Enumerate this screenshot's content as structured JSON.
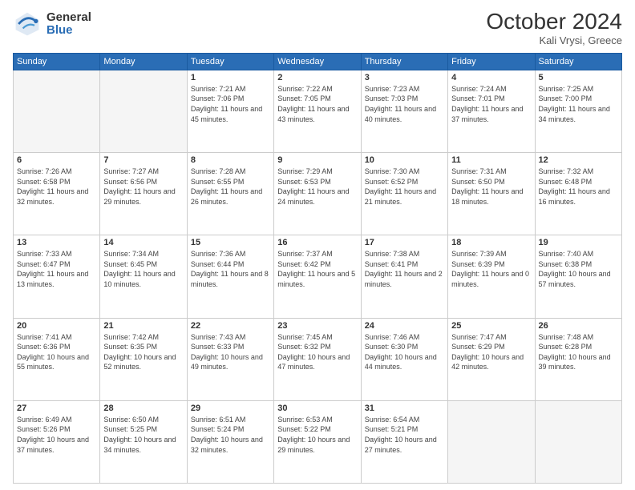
{
  "header": {
    "logo_general": "General",
    "logo_blue": "Blue",
    "month_title": "October 2024",
    "location": "Kali Vrysi, Greece"
  },
  "days_of_week": [
    "Sunday",
    "Monday",
    "Tuesday",
    "Wednesday",
    "Thursday",
    "Friday",
    "Saturday"
  ],
  "weeks": [
    [
      {
        "day": "",
        "content": ""
      },
      {
        "day": "",
        "content": ""
      },
      {
        "day": "1",
        "content": "Sunrise: 7:21 AM\nSunset: 7:06 PM\nDaylight: 11 hours\nand 45 minutes."
      },
      {
        "day": "2",
        "content": "Sunrise: 7:22 AM\nSunset: 7:05 PM\nDaylight: 11 hours\nand 43 minutes."
      },
      {
        "day": "3",
        "content": "Sunrise: 7:23 AM\nSunset: 7:03 PM\nDaylight: 11 hours\nand 40 minutes."
      },
      {
        "day": "4",
        "content": "Sunrise: 7:24 AM\nSunset: 7:01 PM\nDaylight: 11 hours\nand 37 minutes."
      },
      {
        "day": "5",
        "content": "Sunrise: 7:25 AM\nSunset: 7:00 PM\nDaylight: 11 hours\nand 34 minutes."
      }
    ],
    [
      {
        "day": "6",
        "content": "Sunrise: 7:26 AM\nSunset: 6:58 PM\nDaylight: 11 hours\nand 32 minutes."
      },
      {
        "day": "7",
        "content": "Sunrise: 7:27 AM\nSunset: 6:56 PM\nDaylight: 11 hours\nand 29 minutes."
      },
      {
        "day": "8",
        "content": "Sunrise: 7:28 AM\nSunset: 6:55 PM\nDaylight: 11 hours\nand 26 minutes."
      },
      {
        "day": "9",
        "content": "Sunrise: 7:29 AM\nSunset: 6:53 PM\nDaylight: 11 hours\nand 24 minutes."
      },
      {
        "day": "10",
        "content": "Sunrise: 7:30 AM\nSunset: 6:52 PM\nDaylight: 11 hours\nand 21 minutes."
      },
      {
        "day": "11",
        "content": "Sunrise: 7:31 AM\nSunset: 6:50 PM\nDaylight: 11 hours\nand 18 minutes."
      },
      {
        "day": "12",
        "content": "Sunrise: 7:32 AM\nSunset: 6:48 PM\nDaylight: 11 hours\nand 16 minutes."
      }
    ],
    [
      {
        "day": "13",
        "content": "Sunrise: 7:33 AM\nSunset: 6:47 PM\nDaylight: 11 hours\nand 13 minutes."
      },
      {
        "day": "14",
        "content": "Sunrise: 7:34 AM\nSunset: 6:45 PM\nDaylight: 11 hours\nand 10 minutes."
      },
      {
        "day": "15",
        "content": "Sunrise: 7:36 AM\nSunset: 6:44 PM\nDaylight: 11 hours\nand 8 minutes."
      },
      {
        "day": "16",
        "content": "Sunrise: 7:37 AM\nSunset: 6:42 PM\nDaylight: 11 hours\nand 5 minutes."
      },
      {
        "day": "17",
        "content": "Sunrise: 7:38 AM\nSunset: 6:41 PM\nDaylight: 11 hours\nand 2 minutes."
      },
      {
        "day": "18",
        "content": "Sunrise: 7:39 AM\nSunset: 6:39 PM\nDaylight: 11 hours\nand 0 minutes."
      },
      {
        "day": "19",
        "content": "Sunrise: 7:40 AM\nSunset: 6:38 PM\nDaylight: 10 hours\nand 57 minutes."
      }
    ],
    [
      {
        "day": "20",
        "content": "Sunrise: 7:41 AM\nSunset: 6:36 PM\nDaylight: 10 hours\nand 55 minutes."
      },
      {
        "day": "21",
        "content": "Sunrise: 7:42 AM\nSunset: 6:35 PM\nDaylight: 10 hours\nand 52 minutes."
      },
      {
        "day": "22",
        "content": "Sunrise: 7:43 AM\nSunset: 6:33 PM\nDaylight: 10 hours\nand 49 minutes."
      },
      {
        "day": "23",
        "content": "Sunrise: 7:45 AM\nSunset: 6:32 PM\nDaylight: 10 hours\nand 47 minutes."
      },
      {
        "day": "24",
        "content": "Sunrise: 7:46 AM\nSunset: 6:30 PM\nDaylight: 10 hours\nand 44 minutes."
      },
      {
        "day": "25",
        "content": "Sunrise: 7:47 AM\nSunset: 6:29 PM\nDaylight: 10 hours\nand 42 minutes."
      },
      {
        "day": "26",
        "content": "Sunrise: 7:48 AM\nSunset: 6:28 PM\nDaylight: 10 hours\nand 39 minutes."
      }
    ],
    [
      {
        "day": "27",
        "content": "Sunrise: 6:49 AM\nSunset: 5:26 PM\nDaylight: 10 hours\nand 37 minutes."
      },
      {
        "day": "28",
        "content": "Sunrise: 6:50 AM\nSunset: 5:25 PM\nDaylight: 10 hours\nand 34 minutes."
      },
      {
        "day": "29",
        "content": "Sunrise: 6:51 AM\nSunset: 5:24 PM\nDaylight: 10 hours\nand 32 minutes."
      },
      {
        "day": "30",
        "content": "Sunrise: 6:53 AM\nSunset: 5:22 PM\nDaylight: 10 hours\nand 29 minutes."
      },
      {
        "day": "31",
        "content": "Sunrise: 6:54 AM\nSunset: 5:21 PM\nDaylight: 10 hours\nand 27 minutes."
      },
      {
        "day": "",
        "content": ""
      },
      {
        "day": "",
        "content": ""
      }
    ]
  ]
}
